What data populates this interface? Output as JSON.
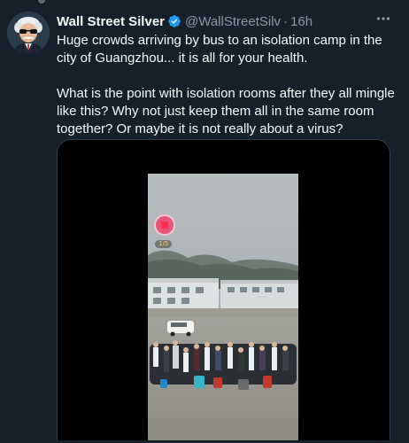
{
  "tweet": {
    "author_name": "Wall Street Silver",
    "handle": "@WallStreetSilv",
    "separator": "·",
    "time": "16h",
    "more_icon": "more-horizontal-icon",
    "paragraphs": [
      "Huge crowds arriving by bus to an isolation camp in the city of Guangzhou... it is all for your health.",
      "What is the point with isolation rooms after they all mingle like this? Why not just keep them all in the same room together? Or maybe it is not really about a virus?"
    ],
    "verified_icon": "verified-badge-icon"
  },
  "media": {
    "overlay_badge_icon": "live-gift-icon",
    "overlay_count": "1/5"
  },
  "colors": {
    "background": "#15202b",
    "text": "#f7f9f9",
    "muted": "#8b98a5",
    "verified": "#1d9bf0"
  }
}
